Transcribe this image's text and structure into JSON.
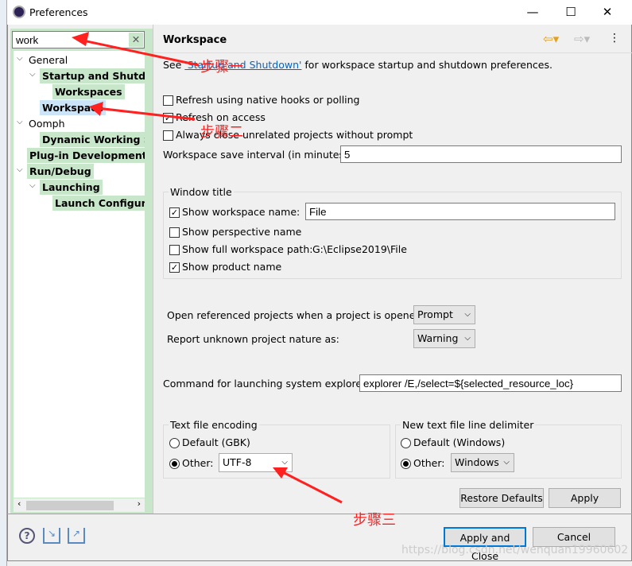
{
  "window": {
    "title": "Preferences",
    "minimize": "—",
    "maximize": "☐",
    "close": "✕"
  },
  "search": {
    "value": "work",
    "clear_icon": "✕"
  },
  "tree": [
    {
      "label": "General",
      "level": 0,
      "expanded": true,
      "bold": false
    },
    {
      "label": "Startup and Shutdow",
      "level": 1,
      "expanded": true,
      "bold": true
    },
    {
      "label": "Workspaces",
      "level": 2,
      "bold": true
    },
    {
      "label": "Workspace",
      "level": 1,
      "bold": true,
      "selected": true
    },
    {
      "label": "Oomph",
      "level": 0,
      "expanded": true,
      "bold": false
    },
    {
      "label": "Dynamic Working Se",
      "level": 1,
      "bold": true
    },
    {
      "label": "Plug-in Development",
      "level": 0,
      "bold": true
    },
    {
      "label": "Run/Debug",
      "level": 0,
      "expanded": true,
      "bold": true
    },
    {
      "label": "Launching",
      "level": 1,
      "expanded": true,
      "bold": true
    },
    {
      "label": "Launch Configurat",
      "level": 2,
      "bold": true
    }
  ],
  "page": {
    "title": "Workspace",
    "see_prefix": "See ",
    "see_link": "'Startup and Shutdown'",
    "see_suffix": " for workspace startup and shutdown preferences.",
    "options": [
      {
        "label": "Refresh using native hooks or polling",
        "checked": false
      },
      {
        "label": "Refresh on access",
        "checked": true
      },
      {
        "label": "Always close unrelated projects without prompt",
        "checked": false
      }
    ],
    "save_interval_label": "Workspace save interval (in minutes):",
    "save_interval_value": "5",
    "window_title": {
      "group": "Window title",
      "show_workspace_name": {
        "label": "Show workspace name:",
        "checked": true,
        "value": "File"
      },
      "show_perspective_name": {
        "label": "Show perspective name",
        "checked": false
      },
      "show_full_path": {
        "label": "Show full workspace path:",
        "checked": false,
        "value": "G:\\Eclipse2019\\File"
      },
      "show_product_name": {
        "label": "Show product name",
        "checked": true
      }
    },
    "open_ref_label": "Open referenced projects when a project is opened:",
    "open_ref_value": "Prompt",
    "unknown_nature_label": "Report unknown project nature as:",
    "unknown_nature_value": "Warning",
    "explorer_label": "Command for launching system explorer:",
    "explorer_value": "explorer /E,/select=${selected_resource_loc}",
    "encoding": {
      "group": "Text file encoding",
      "default": "Default (GBK)",
      "other": "Other:",
      "value": "UTF-8",
      "selected": "other"
    },
    "delimiter": {
      "group": "New text file line delimiter",
      "default": "Default (Windows)",
      "other": "Other:",
      "value": "Windows",
      "selected": "other"
    },
    "restore_defaults": "Restore Defaults",
    "apply": "Apply"
  },
  "footer": {
    "apply_close": "Apply and Close",
    "cancel": "Cancel",
    "help_icon": "?"
  },
  "annotations": {
    "step1": "步骤一",
    "step2": "步骤二",
    "step3": "步骤三",
    "arrow_color": "#ff2020"
  },
  "watermark": "https://blog.csdn.net/wenquan19960602"
}
